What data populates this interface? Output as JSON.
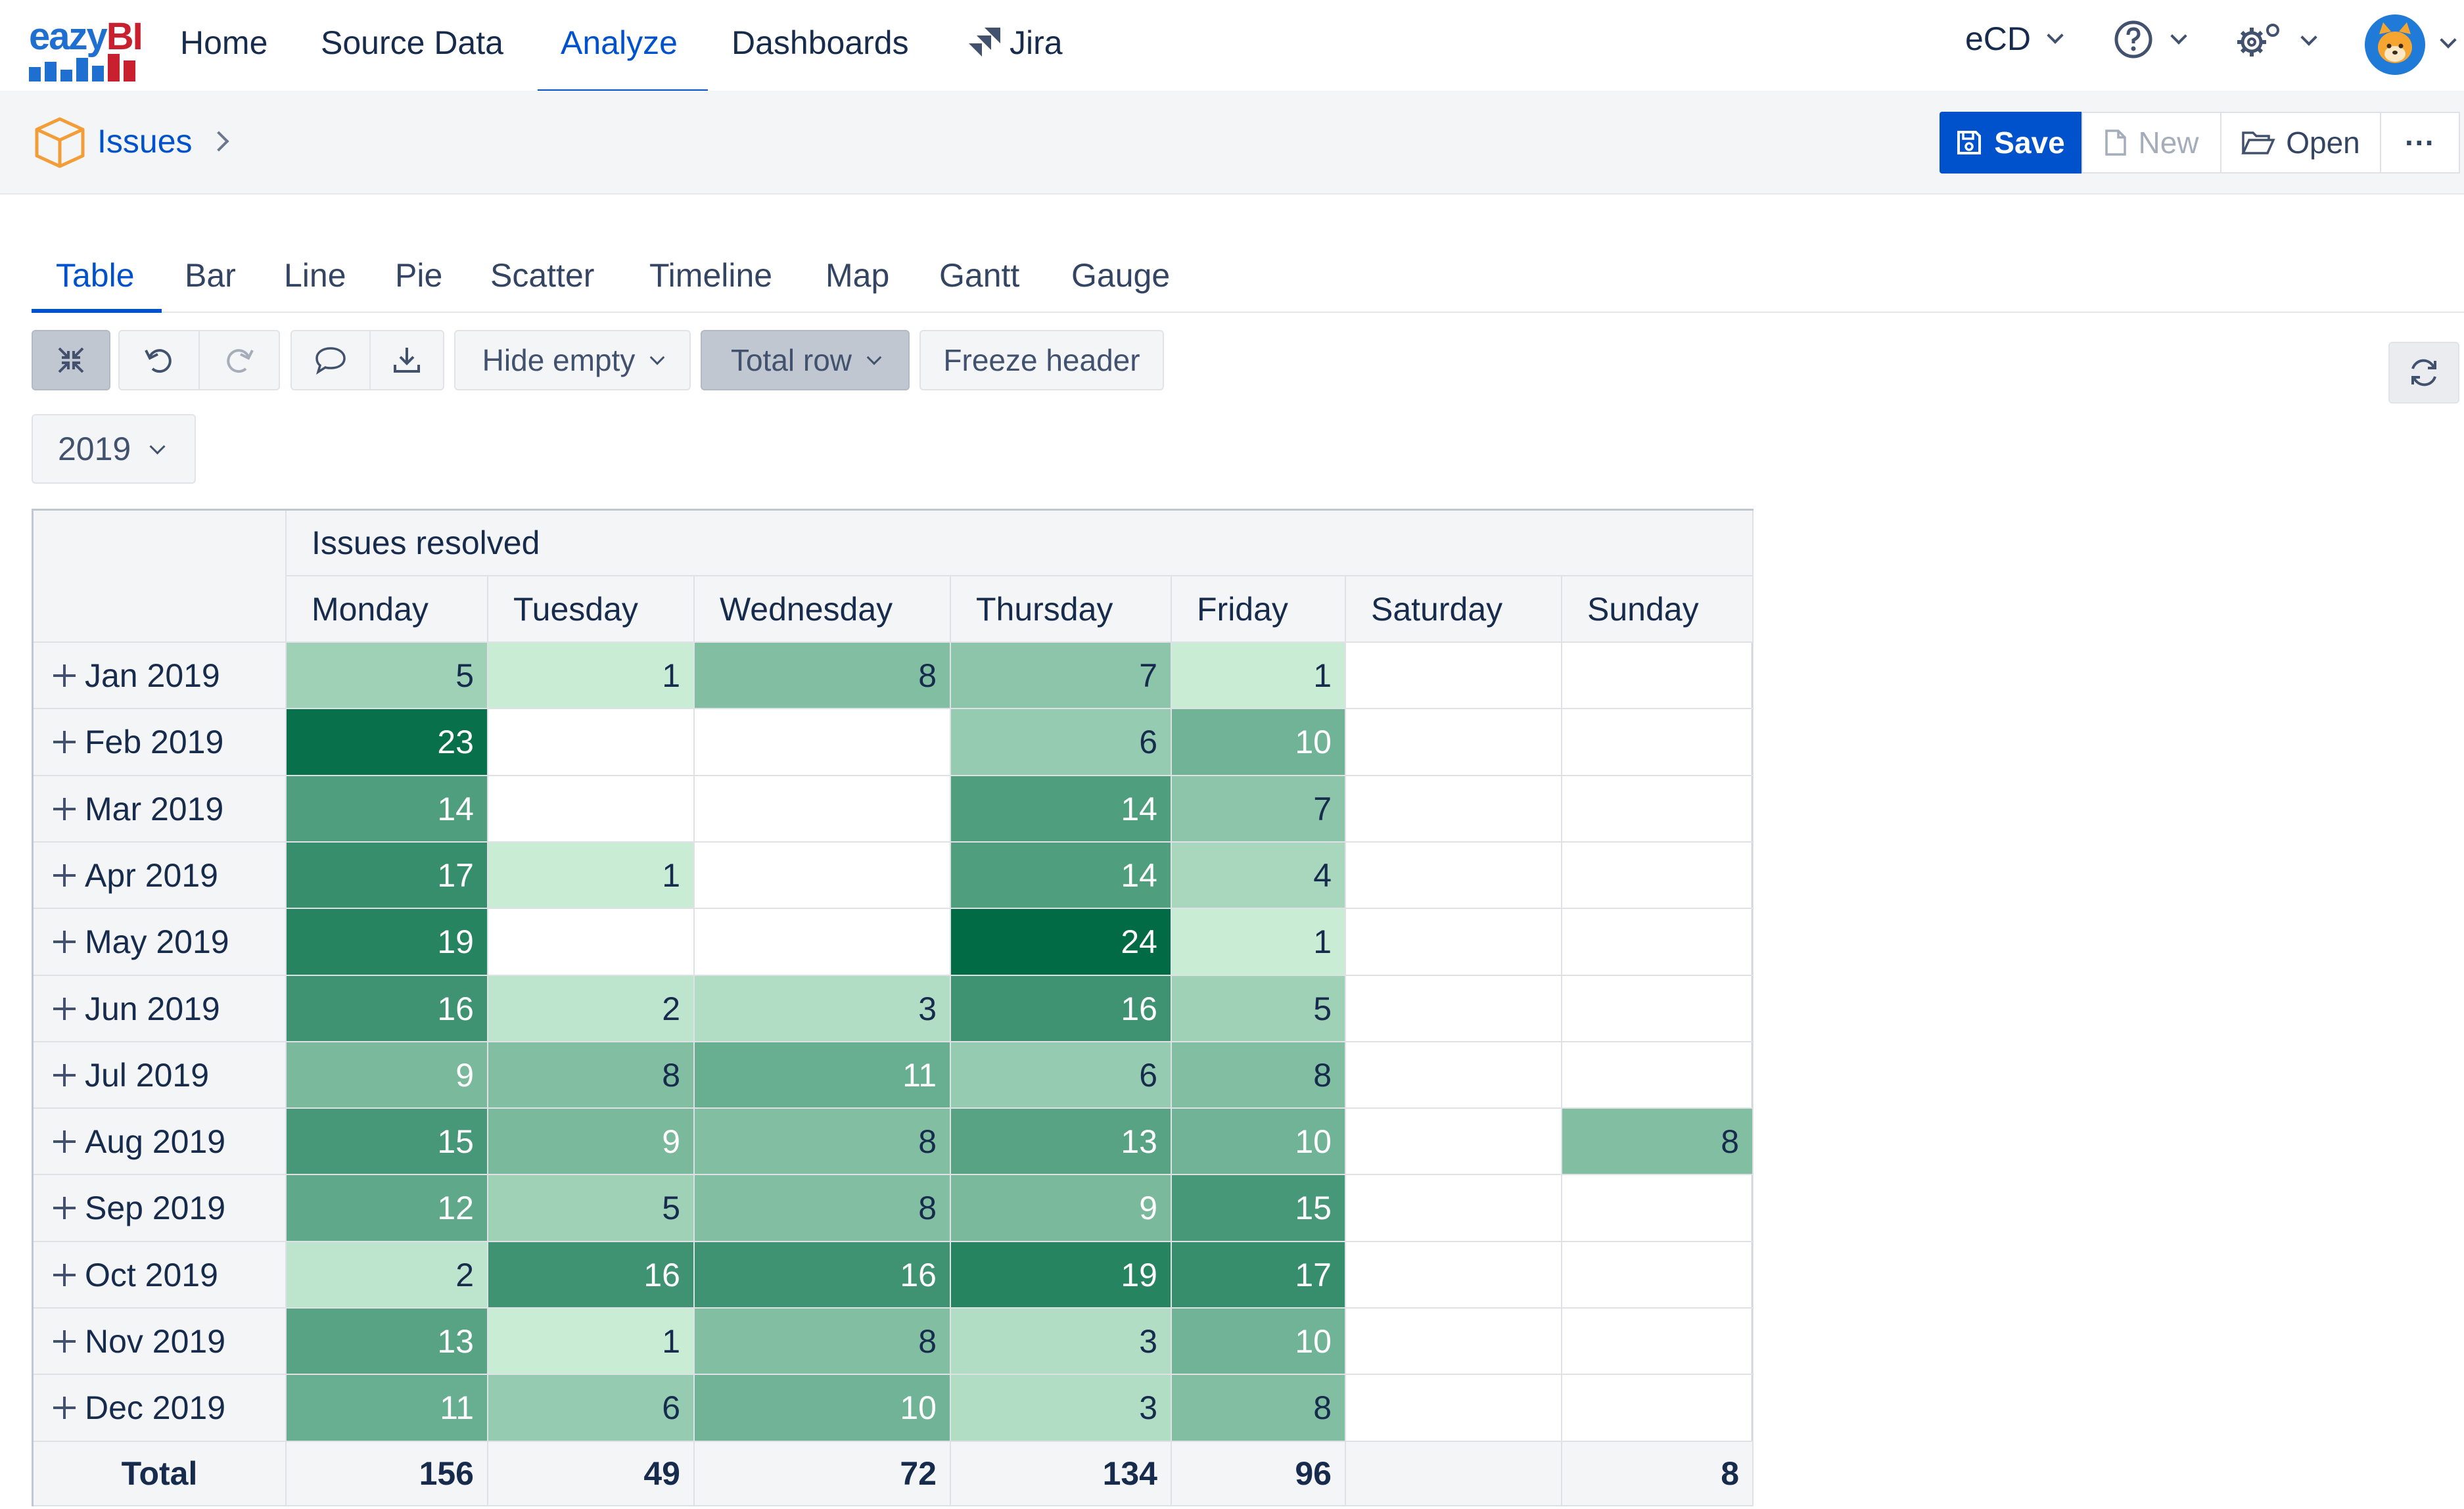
{
  "app": {
    "logo_text": "eazyBI",
    "nav": [
      "Home",
      "Source Data",
      "Analyze",
      "Dashboards",
      "Jira"
    ],
    "active_nav": "Analyze",
    "account": "eCD"
  },
  "breadcrumb": {
    "cube": "Issues"
  },
  "actions": {
    "save": "Save",
    "new": "New",
    "open": "Open",
    "more": "···"
  },
  "chart_tabs": [
    "Table",
    "Bar",
    "Line",
    "Pie",
    "Scatter",
    "Timeline",
    "Map",
    "Gantt",
    "Gauge"
  ],
  "active_chart_tab": "Table",
  "toolbar": {
    "hide_empty": "Hide empty",
    "total_row": "Total row",
    "freeze_header": "Freeze header"
  },
  "page_filter": {
    "year": "2019"
  },
  "colors": {
    "accent": "#0052cc",
    "heat_low": "#d7f5df",
    "heat_high": "#006b45"
  },
  "table": {
    "measure": "Issues resolved",
    "columns": [
      "Monday",
      "Tuesday",
      "Wednesday",
      "Thursday",
      "Friday",
      "Saturday",
      "Sunday"
    ],
    "rows": [
      {
        "label": "Jan 2019",
        "values": [
          "5",
          "1",
          "8",
          "7",
          "1",
          "",
          ""
        ]
      },
      {
        "label": "Feb 2019",
        "values": [
          "23",
          "",
          "",
          "6",
          "10",
          "",
          ""
        ]
      },
      {
        "label": "Mar 2019",
        "values": [
          "14",
          "",
          "",
          "14",
          "7",
          "",
          ""
        ]
      },
      {
        "label": "Apr 2019",
        "values": [
          "17",
          "1",
          "",
          "14",
          "4",
          "",
          ""
        ]
      },
      {
        "label": "May 2019",
        "values": [
          "19",
          "",
          "",
          "24",
          "1",
          "",
          ""
        ]
      },
      {
        "label": "Jun 2019",
        "values": [
          "16",
          "2",
          "3",
          "16",
          "5",
          "",
          ""
        ]
      },
      {
        "label": "Jul 2019",
        "values": [
          "9",
          "8",
          "11",
          "6",
          "8",
          "",
          ""
        ]
      },
      {
        "label": "Aug 2019",
        "values": [
          "15",
          "9",
          "8",
          "13",
          "10",
          "",
          "8"
        ]
      },
      {
        "label": "Sep 2019",
        "values": [
          "12",
          "5",
          "8",
          "9",
          "15",
          "",
          ""
        ]
      },
      {
        "label": "Oct 2019",
        "values": [
          "2",
          "16",
          "16",
          "19",
          "17",
          "",
          ""
        ]
      },
      {
        "label": "Nov 2019",
        "values": [
          "13",
          "1",
          "8",
          "3",
          "10",
          "",
          ""
        ]
      },
      {
        "label": "Dec 2019",
        "values": [
          "11",
          "6",
          "10",
          "3",
          "8",
          "",
          ""
        ]
      }
    ],
    "total": {
      "label": "Total",
      "values": [
        "156",
        "49",
        "72",
        "134",
        "96",
        "",
        "8"
      ]
    }
  }
}
